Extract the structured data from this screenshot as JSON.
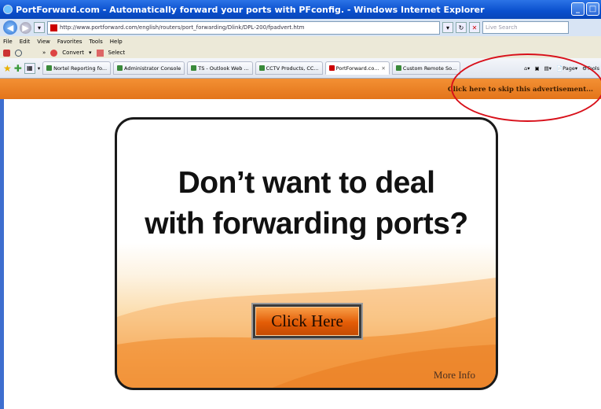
{
  "window": {
    "title": "PortForward.com - Automatically forward your ports with PFconfig. - Windows Internet Explorer"
  },
  "address_bar": {
    "url": "http://www.portforward.com/english/routers/port_forwarding/Dlink/DPL-200/fpadvert.htm",
    "search_placeholder": "Live Search"
  },
  "menu": {
    "items": [
      "File",
      "Edit",
      "View",
      "Favorites",
      "Tools",
      "Help"
    ]
  },
  "toolbar": {
    "convert_label": "Convert",
    "select_label": "Select"
  },
  "tabs": [
    {
      "label": "Nortel Reporting fo..."
    },
    {
      "label": "Administrator Console"
    },
    {
      "label": "TS - Outlook Web ..."
    },
    {
      "label": "CCTV Products, CC..."
    },
    {
      "label": "PortForward.co..."
    },
    {
      "label": "Custom Remote So..."
    }
  ],
  "command_bar": {
    "page_label": "Page",
    "tools_label": "Tools"
  },
  "ad_strip": {
    "skip_link": "Click here to skip this advertisement..."
  },
  "ad": {
    "headline_line1": "Don’t want to deal",
    "headline_line2": "with forwarding ports?",
    "button_label": "Click Here",
    "more_info": "More Info"
  },
  "colors": {
    "accent_orange": "#e3741a",
    "titlebar_blue": "#0a4fcd",
    "highlight_red": "#d8101a"
  }
}
